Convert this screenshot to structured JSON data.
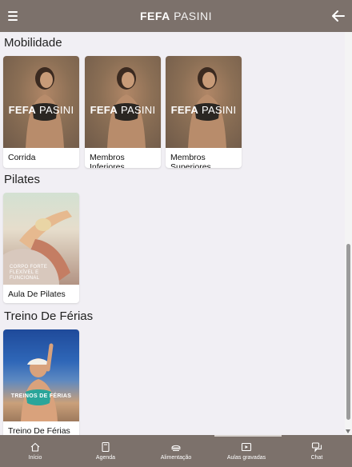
{
  "header": {
    "brand_bold": "FEFA",
    "brand_light": "PASINI"
  },
  "sections": [
    {
      "title": "Mobilidade",
      "cards": [
        {
          "label": "Corrida",
          "watermark_bold": "FEFA",
          "watermark_light": "PASINI"
        },
        {
          "label": "Membros Inferiores",
          "watermark_bold": "FEFA",
          "watermark_light": "PASINI"
        },
        {
          "label": "Membros Superiores",
          "watermark_bold": "FEFA",
          "watermark_light": "PASINI"
        }
      ]
    },
    {
      "title": "Pilates",
      "cards": [
        {
          "label": "Aula De Pilates",
          "overlay": "CORPO FORTE FLEXÍVEL E FUNCIONAL"
        }
      ]
    },
    {
      "title": "Treino De Férias",
      "cards": [
        {
          "label": "Treino De Férias",
          "overlay": "TREINOS DE FÉRIAS"
        }
      ]
    }
  ],
  "bottom_nav": [
    {
      "label": "Início",
      "icon": "home-icon"
    },
    {
      "label": "Agenda",
      "icon": "book-icon"
    },
    {
      "label": "Alimentação",
      "icon": "food-icon"
    },
    {
      "label": "Aulas gravadas",
      "icon": "video-icon"
    },
    {
      "label": "Chat",
      "icon": "chat-icon"
    }
  ],
  "colors": {
    "bar": "#7c716b",
    "background": "#f1eff4"
  }
}
